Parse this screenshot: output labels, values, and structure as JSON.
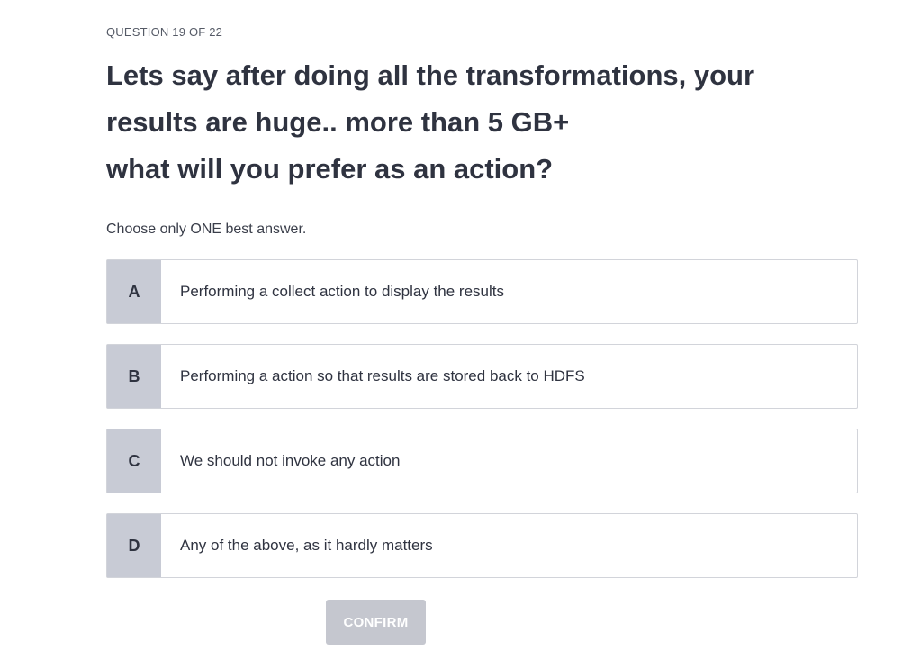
{
  "quiz": {
    "counter": "QUESTION 19 OF 22",
    "question_lines": [
      "Lets say after doing all the transformations, your",
      "results are huge.. more than 5 GB+",
      "what will you prefer as an action?"
    ],
    "instruction": "Choose only ONE best answer.",
    "options": [
      {
        "letter": "A",
        "text": "Performing a collect action to display the results"
      },
      {
        "letter": "B",
        "text": "Performing a action so that results are stored back to HDFS"
      },
      {
        "letter": "C",
        "text": "We should not invoke any action"
      },
      {
        "letter": "D",
        "text": "Any of the above, as it hardly matters"
      }
    ],
    "confirm_label": "CONFIRM"
  },
  "colors": {
    "letter_bg": "#c8cbd5",
    "option_border": "#d2d4da",
    "confirm_bg": "#c5c7cf",
    "text": "#2f3340"
  }
}
